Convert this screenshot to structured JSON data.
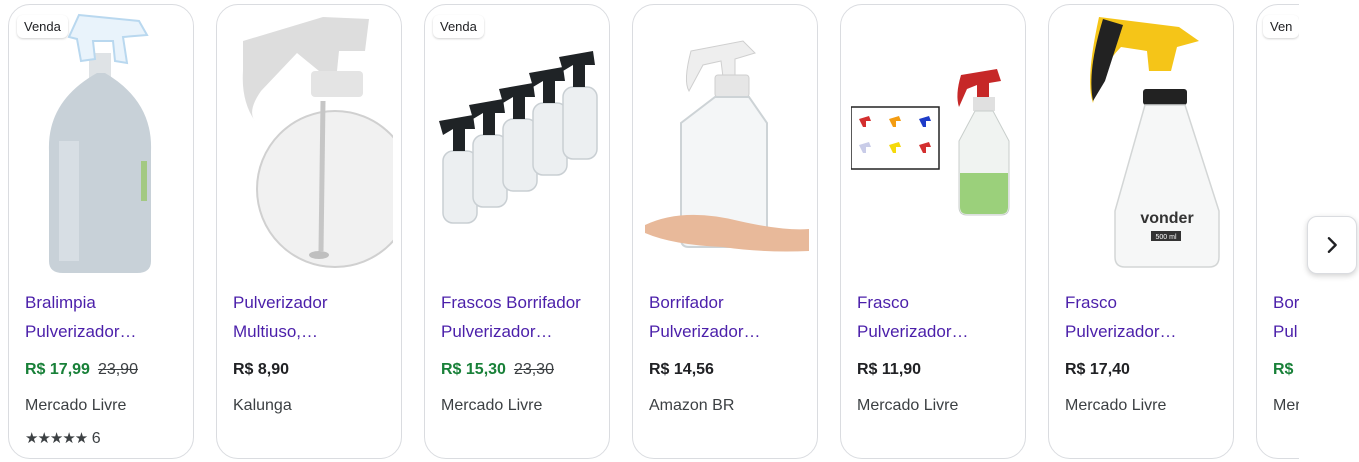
{
  "products": [
    {
      "badge": "Venda",
      "title_line1": "Bralimpia",
      "title_line2": "Pulverizador…",
      "price": "R$ 17,99",
      "old_price": "23,90",
      "store": "Mercado Livre",
      "stars": "★★★★★",
      "rating_count": "6"
    },
    {
      "badge": "",
      "title_line1": "Pulverizador",
      "title_line2": "Multiuso,…",
      "price": "R$ 8,90",
      "old_price": "",
      "store": "Kalunga",
      "stars": "",
      "rating_count": ""
    },
    {
      "badge": "Venda",
      "title_line1": "Frascos Borrifador",
      "title_line2": "Pulverizador…",
      "price": "R$ 15,30",
      "old_price": "23,30",
      "store": "Mercado Livre",
      "stars": "",
      "rating_count": ""
    },
    {
      "badge": "",
      "title_line1": "Borrifador",
      "title_line2": "Pulverizador…",
      "price": "R$ 14,56",
      "old_price": "",
      "store": "Amazon BR",
      "stars": "",
      "rating_count": ""
    },
    {
      "badge": "",
      "title_line1": "Frasco",
      "title_line2": "Pulverizador…",
      "price": "R$ 11,90",
      "old_price": "",
      "store": "Mercado Livre",
      "stars": "",
      "rating_count": ""
    },
    {
      "badge": "",
      "title_line1": "Frasco",
      "title_line2": "Pulverizador…",
      "price": "R$ 17,40",
      "old_price": "",
      "store": "Mercado Livre",
      "stars": "",
      "rating_count": ""
    },
    {
      "badge": "Ven",
      "title_line1": "Bor",
      "title_line2": "Pul",
      "price": "R$",
      "old_price": "",
      "store": "Mer",
      "stars": "",
      "rating_count": ""
    }
  ],
  "product_brand_label": "vonder",
  "product_volume_label": "500 ml",
  "next_icon": "chevron-right-icon",
  "colors": {
    "title": "#4b1faa",
    "sale_price": "#188038",
    "text": "#202124",
    "secondary": "#3c4043",
    "border": "#dadce0"
  }
}
